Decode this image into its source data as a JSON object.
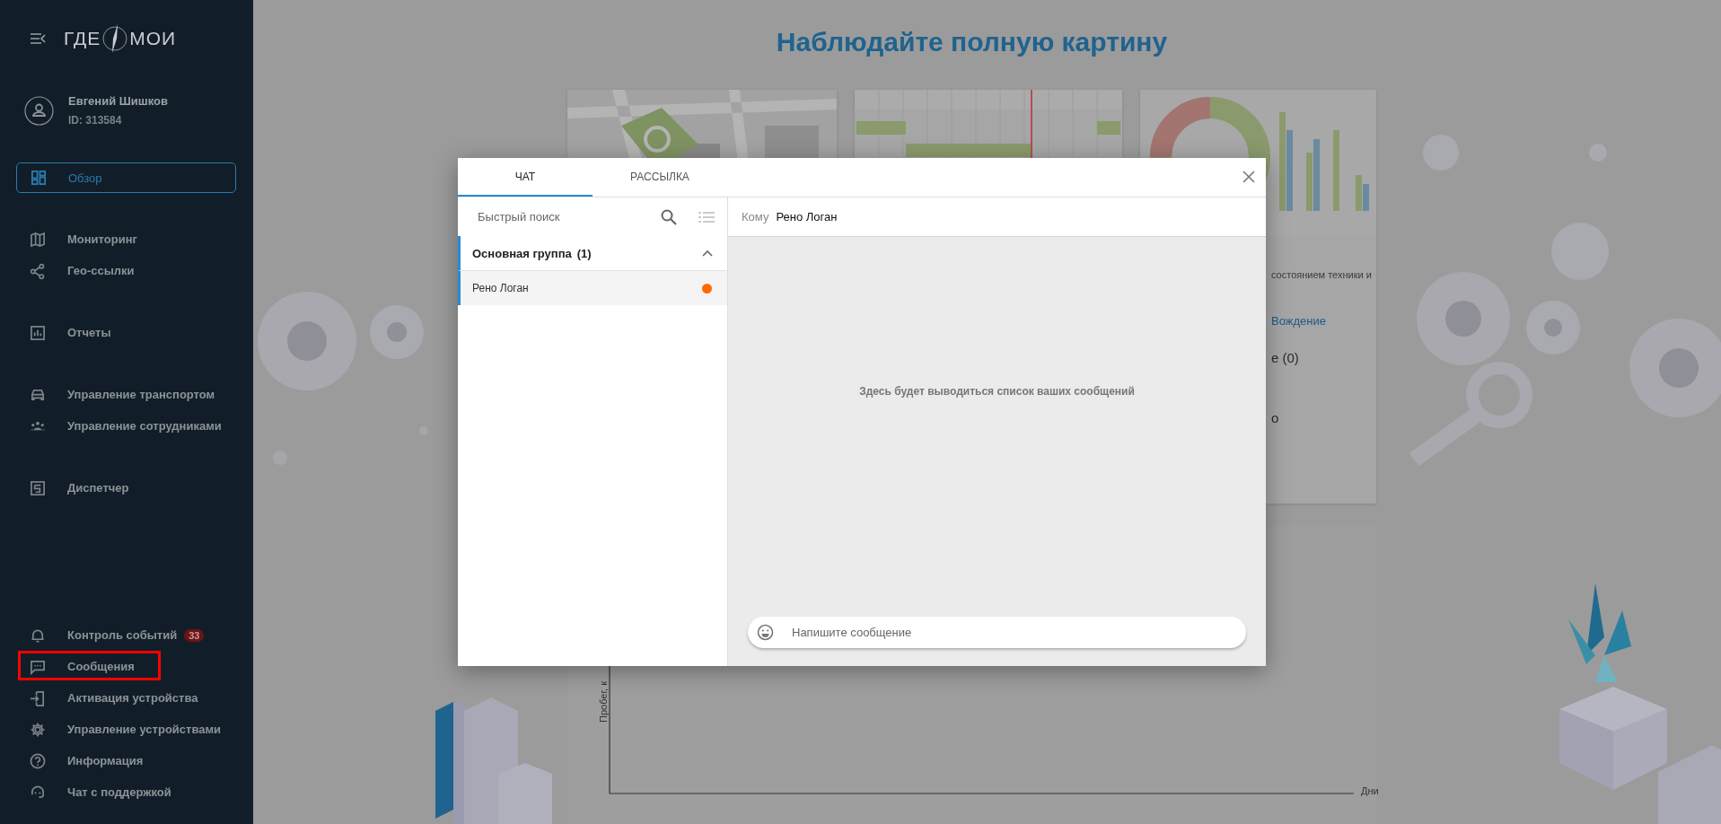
{
  "sidebar": {
    "logo": {
      "left": "ГДЕ",
      "right": "МОИ"
    },
    "user": {
      "name": "Евгений Шишков",
      "id": "ID: 313584"
    },
    "nav_groups": [
      [
        {
          "label": "Обзор",
          "selected": true,
          "annotated": false
        }
      ],
      [
        {
          "label": "Мониторинг",
          "selected": false,
          "annotated": false
        },
        {
          "label": "Гео-ссылки",
          "selected": false,
          "annotated": false
        }
      ],
      [
        {
          "label": "Отчеты",
          "selected": false,
          "annotated": false
        }
      ],
      [
        {
          "label": "Управление транспортом",
          "selected": false,
          "annotated": false
        },
        {
          "label": "Управление сотрудниками",
          "selected": false,
          "annotated": false
        }
      ],
      [
        {
          "label": "Диспетчер",
          "selected": false,
          "annotated": false
        }
      ]
    ],
    "bottom_items": [
      {
        "label": "Контроль событий",
        "selected": false,
        "annotated": false,
        "badge": "33"
      },
      {
        "label": "Сообщения",
        "selected": false,
        "annotated": true
      },
      {
        "label": "Активация устройства",
        "selected": false,
        "annotated": false
      },
      {
        "label": "Управление устройствами",
        "selected": false,
        "annotated": false
      },
      {
        "label": "Информация",
        "selected": false,
        "annotated": false
      },
      {
        "label": "Чат с поддержкой",
        "selected": false,
        "annotated": false
      }
    ]
  },
  "background": {
    "title": "Наблюдайте полную картину",
    "card_texts": [
      {
        "kind": "text",
        "text": "состоянием техники и"
      },
      {
        "kind": "link",
        "text": "Вождение"
      },
      {
        "kind": "large",
        "text": "е (0)"
      },
      {
        "kind": "large",
        "text": "о"
      }
    ],
    "chart": {
      "ylabel": "Пробег, к",
      "xlabel": "Дни"
    }
  },
  "dialog": {
    "tabs": [
      {
        "label": "ЧАТ",
        "selected": true
      },
      {
        "label": "РАССЫЛКА",
        "selected": false
      }
    ],
    "search": {
      "placeholder": "Быстрый поиск"
    },
    "groups": [
      {
        "name": "Основная группа",
        "count": "(1)",
        "expanded": true,
        "contacts": [
          {
            "name": "Рено Логан",
            "selected": true,
            "color": "#ff6a00"
          }
        ]
      }
    ],
    "recipient": {
      "label": "Кому",
      "value": "Рено Логан"
    },
    "empty_text": "Здесь будет выводиться список ваших сообщений",
    "message": {
      "placeholder": "Напишите сообщение"
    }
  }
}
